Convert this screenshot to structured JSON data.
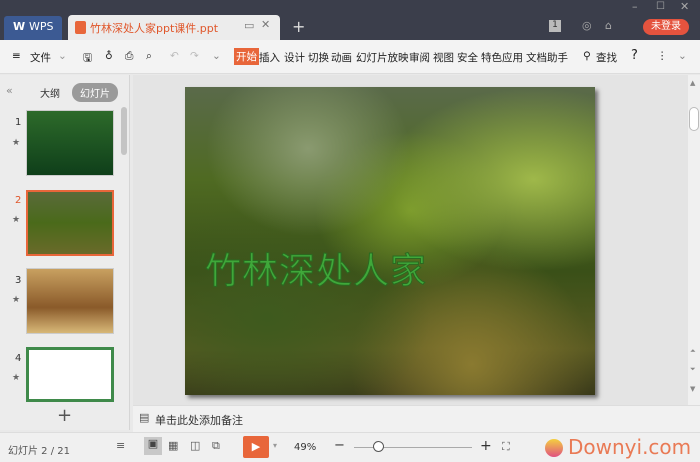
{
  "window": {
    "app_tab": "WPS",
    "doc_tab": "竹林深处人家ppt课件.ppt",
    "login": "未登录",
    "badge": "1"
  },
  "toolbar": {
    "file": "文件",
    "tabs": [
      "开始",
      "插入",
      "设计",
      "切换",
      "动画",
      "幻灯片放映",
      "审阅",
      "视图",
      "安全",
      "特色应用",
      "文档助手"
    ],
    "active_tab": "开始",
    "search": "查找"
  },
  "panel": {
    "tabs": [
      "大纲",
      "幻灯片"
    ],
    "active": "幻灯片",
    "slides": [
      "1",
      "2",
      "3",
      "4"
    ],
    "selected": "2"
  },
  "slide": {
    "title": "竹林深处人家"
  },
  "notes": {
    "placeholder": "单击此处添加备注"
  },
  "status": {
    "slide_counter": "幻灯片 2 / 21",
    "zoom": "49%",
    "zoom_value": 49
  },
  "colors": {
    "accent": "#e8663a",
    "titlebar": "#3b3e4b",
    "wps_tab": "#3c5a93"
  },
  "watermark": "Downyi.com"
}
